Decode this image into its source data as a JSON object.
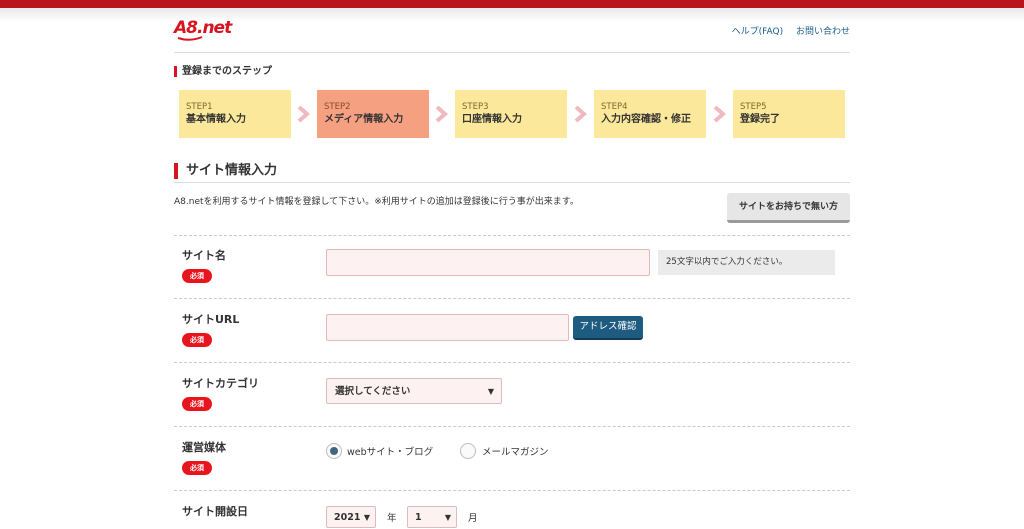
{
  "header": {
    "logo_text": "A8.net",
    "links": [
      "ヘルプ(FAQ)",
      "お問い合わせ"
    ]
  },
  "steps_title": "登録までのステップ",
  "steps": [
    {
      "num": "STEP1",
      "name": "基本情報入力",
      "active": false
    },
    {
      "num": "STEP2",
      "name": "メディア情報入力",
      "active": true
    },
    {
      "num": "STEP3",
      "name": "口座情報入力",
      "active": false
    },
    {
      "num": "STEP4",
      "name": "入力内容確認・修正",
      "active": false
    },
    {
      "num": "STEP5",
      "name": "登録完了",
      "active": false
    }
  ],
  "section_title": "サイト情報入力",
  "intro_text": "A8.netを利用するサイト情報を登録して下さい。※利用サイトの追加は登録後に行う事が出来ます。",
  "no_site_button": "サイトをお持ちで無い方",
  "required_badge": "必須",
  "fields": {
    "site_name": {
      "label": "サイト名",
      "value": "",
      "hint": "25文字以内でご入力ください。"
    },
    "site_url": {
      "label": "サイトURL",
      "value": "",
      "check_button": "アドレス確認"
    },
    "site_category": {
      "label": "サイトカテゴリ",
      "selected": "選択してください"
    },
    "media": {
      "label": "運営媒体",
      "options": [
        "webサイト・ブログ",
        "メールマガジン"
      ],
      "selected_index": 0
    },
    "open_date": {
      "label": "サイト開設日",
      "year": "2021",
      "year_unit": "年",
      "month": "1",
      "month_unit": "月"
    }
  },
  "colors": {
    "brand_red": "#d7141f",
    "step_default": "#fbe89a",
    "step_active": "#f5a080",
    "step_arrow": "#f2b8c0",
    "button_blue": "#1d5b80",
    "input_bg": "#fdf1f1"
  }
}
